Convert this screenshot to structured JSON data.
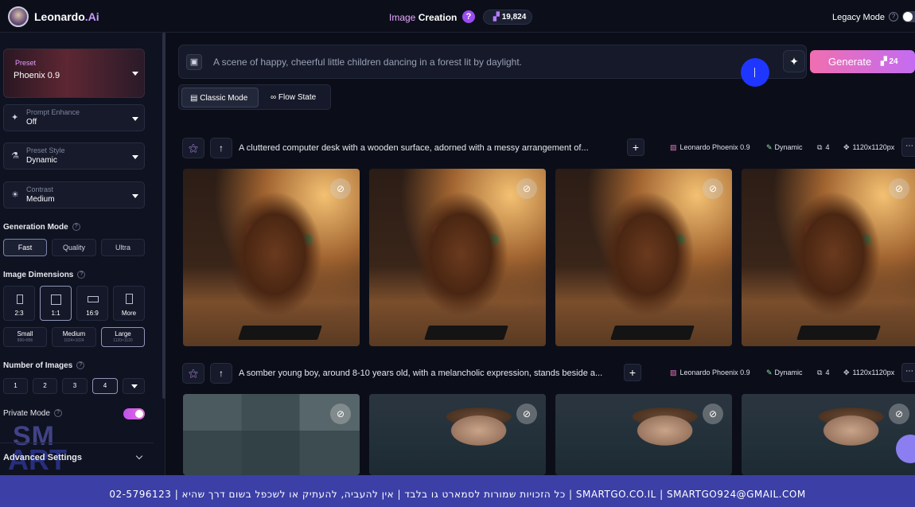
{
  "app": {
    "brand": "Leonardo",
    "brand_suffix": ".Ai",
    "title_part1": "Image",
    "title_part2": "Creation",
    "help": "?",
    "tokens": "19,824",
    "legacy_mode": "Legacy Mode"
  },
  "sidebar": {
    "preset": {
      "label": "Preset",
      "value": "Phoenix 0.9"
    },
    "prompt_enhance": {
      "label": "Prompt Enhance",
      "value": "Off"
    },
    "preset_style": {
      "label": "Preset Style",
      "value": "Dynamic"
    },
    "contrast": {
      "label": "Contrast",
      "value": "Medium"
    },
    "generation_mode": {
      "title": "Generation Mode",
      "options": [
        "Fast",
        "Quality",
        "Ultra"
      ],
      "selected": "Fast"
    },
    "image_dimensions": {
      "title": "Image Dimensions",
      "ratios": [
        "2:3",
        "1:1",
        "16:9",
        "More"
      ],
      "selected_ratio": "1:1",
      "sizes": [
        {
          "label": "Small",
          "sub": "896×896"
        },
        {
          "label": "Medium",
          "sub": "1024×1024"
        },
        {
          "label": "Large",
          "sub": "1120×1120"
        }
      ],
      "selected_size": "Large"
    },
    "number_of_images": {
      "title": "Number of Images",
      "options": [
        "1",
        "2",
        "3",
        "4"
      ],
      "selected": "4"
    },
    "private_mode": {
      "label": "Private Mode",
      "enabled": true
    },
    "advanced_settings": "Advanced Settings",
    "watermark": {
      "line1": "SM",
      "line2": "ART GO"
    }
  },
  "prompt": {
    "text": "A scene of happy, cheerful little children dancing in a forest lit by daylight.",
    "generate_label": "Generate",
    "generate_cost": "24"
  },
  "modes": {
    "classic": "Classic Mode",
    "flow": "Flow State"
  },
  "generations": [
    {
      "prompt": "A cluttered computer desk with a wooden surface, adorned with a messy arrangement of...",
      "model": "Leonardo Phoenix 0.9",
      "style": "Dynamic",
      "count": "4",
      "size": "1120x1120px"
    },
    {
      "prompt": "A somber young boy, around 8-10 years old, with a melancholic expression, stands beside a...",
      "model": "Leonardo Phoenix 0.9",
      "style": "Dynamic",
      "count": "4",
      "size": "1120x1120px"
    }
  ],
  "footer": "כל הזכויות שמורות לסמארט גו בלבד | אין להעביה, להעתיק או לשכפל בשום דרך שהיא | 02-5796123 | SMARTGO.CO.IL | SMARTGO924@GMAIL.COM",
  "colors": {
    "accent": "#c36cf2",
    "generate_start": "#f06eb0",
    "footer_bg": "#3b3fa6",
    "cursor_dot": "#1e36ff"
  },
  "icons": {
    "hide": "eye-off-icon",
    "enhance": "sparkle-icon",
    "image": "image-icon",
    "up": "arrow-up-icon",
    "plus": "plus-icon"
  }
}
